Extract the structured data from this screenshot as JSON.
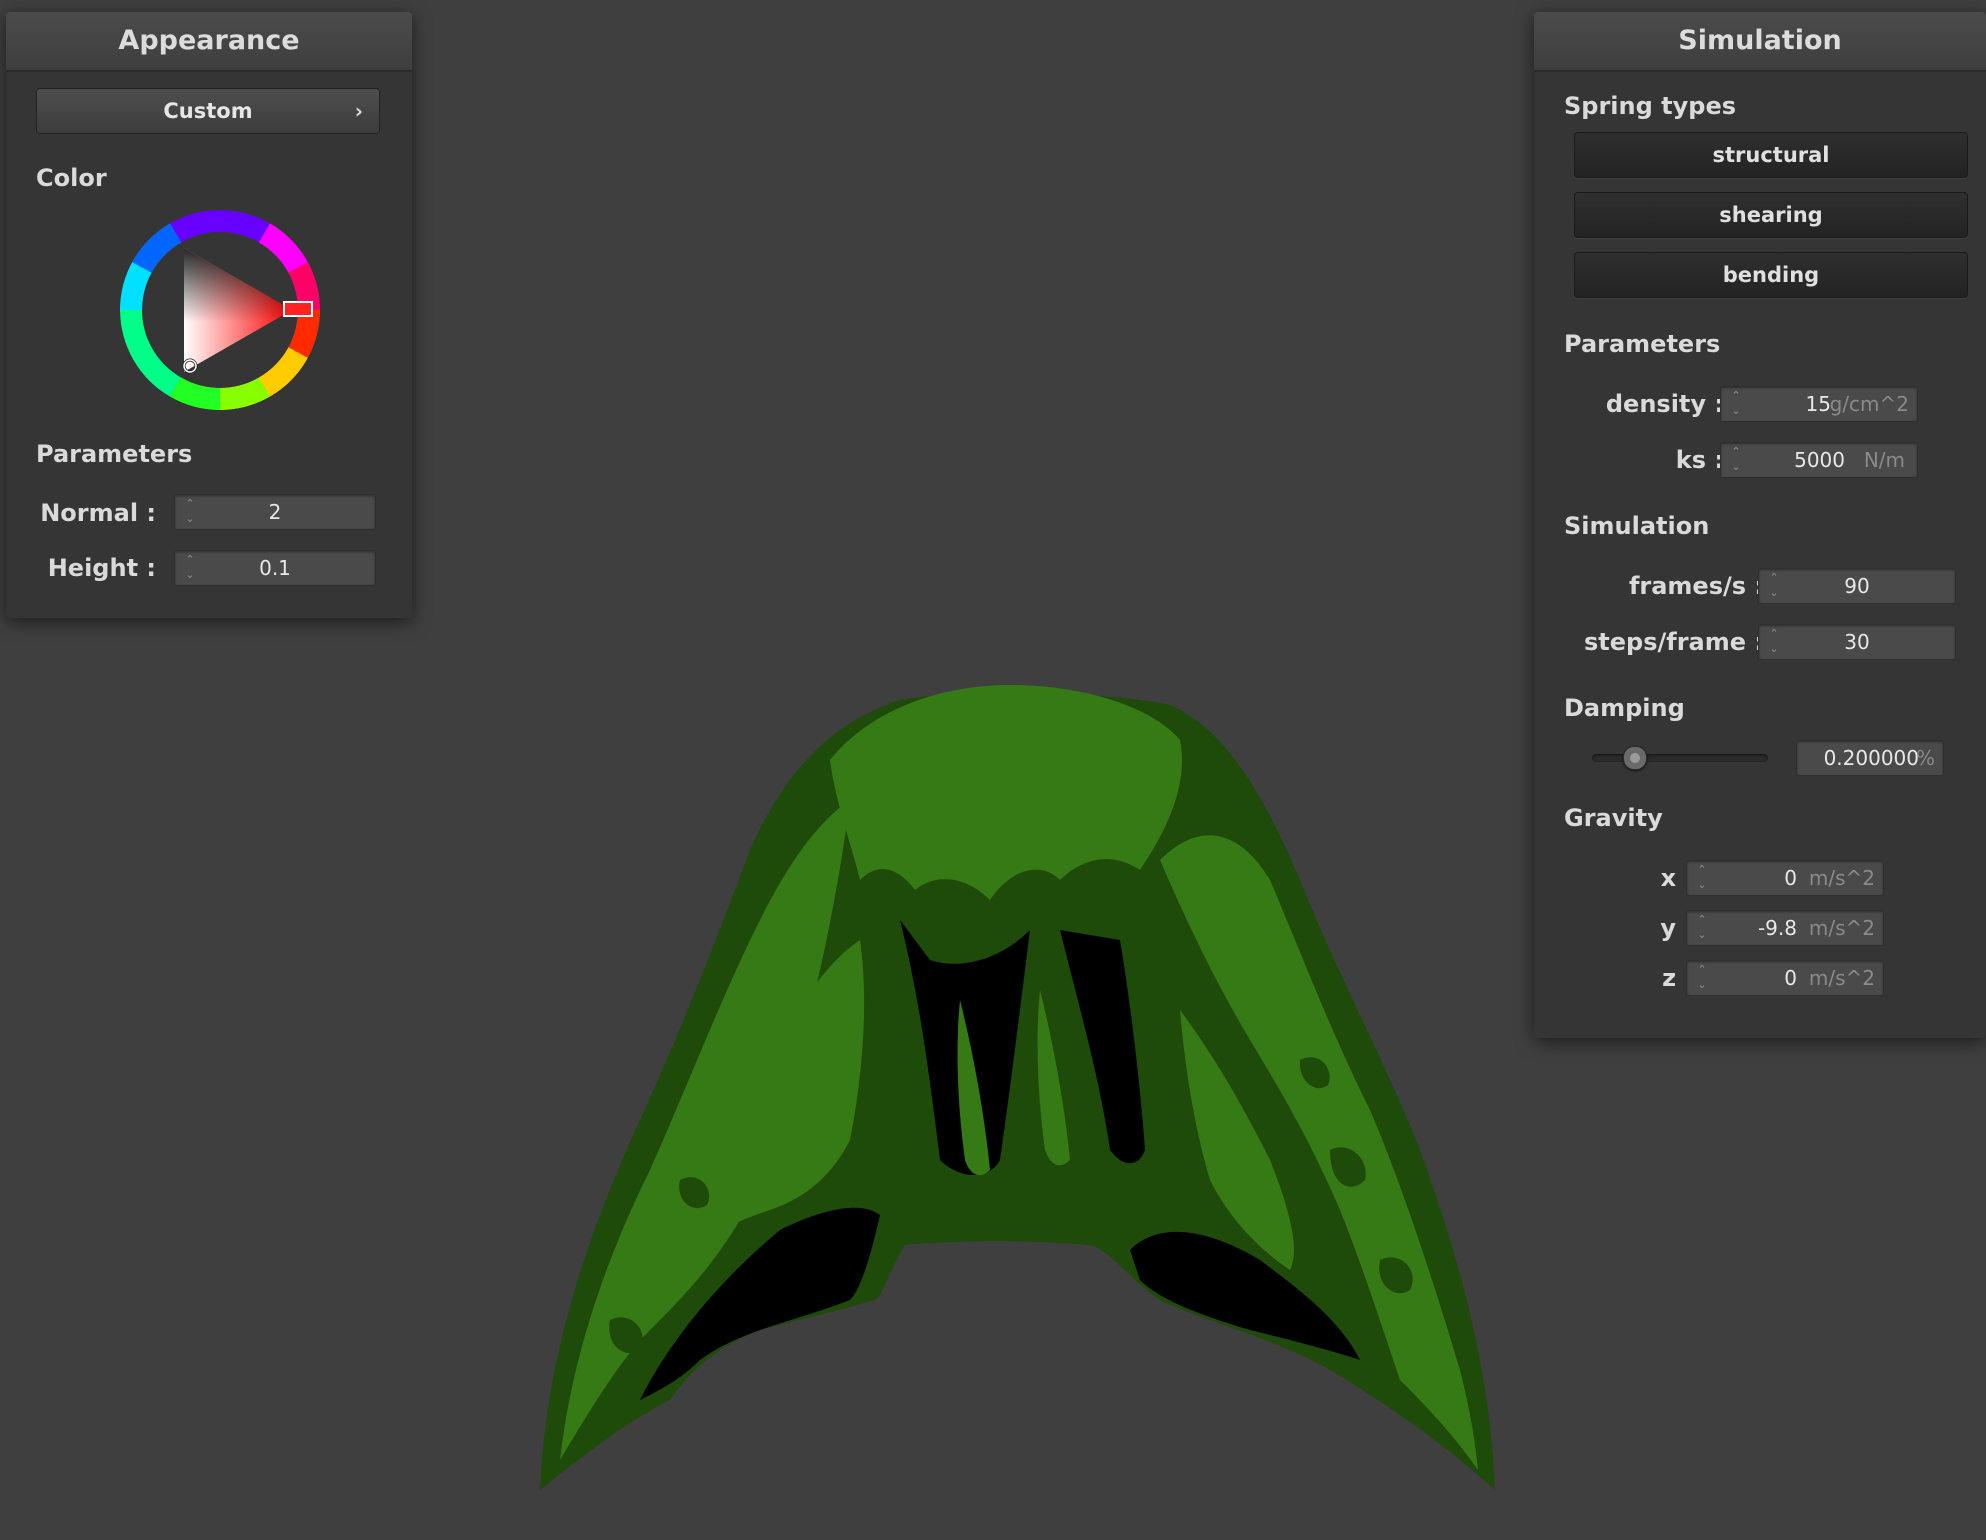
{
  "appearance": {
    "title": "Appearance",
    "preset_label": "Custom",
    "color_label": "Color",
    "params_label": "Parameters",
    "normal_label": "Normal :",
    "normal_value": "2",
    "height_label": "Height :",
    "height_value": "0.1",
    "selected_color": "#ff0000"
  },
  "simulation": {
    "title": "Simulation",
    "spring_types_label": "Spring types",
    "spring_buttons": [
      "structural",
      "shearing",
      "bending"
    ],
    "params_label": "Parameters",
    "density_label": "density :",
    "density_value": "15",
    "density_unit": "g/cm^2",
    "ks_label": "ks :",
    "ks_value": "5000",
    "ks_unit": "N/m",
    "sim_label": "Simulation",
    "fps_label": "frames/s :",
    "fps_value": "90",
    "steps_label": "steps/frame :",
    "steps_value": "30",
    "damping_label": "Damping",
    "damping_value": "0.200000",
    "damping_unit": "%",
    "damping_fraction": 0.2,
    "gravity_label": "Gravity",
    "gx_label": "x :",
    "gx_value": "0",
    "gy_label": "y :",
    "gy_value": "-9.8",
    "gz_label": "z :",
    "gz_value": "0",
    "g_unit": "m/s^2"
  },
  "colors": {
    "cloth_light": "#357a14",
    "cloth_mid": "#1e4a0a",
    "cloth_dark": "#000000",
    "background": "#3f3f3f"
  },
  "icons": {
    "preset_chevron": "chevron-right-icon",
    "spinner": "spin-arrows-icon"
  }
}
